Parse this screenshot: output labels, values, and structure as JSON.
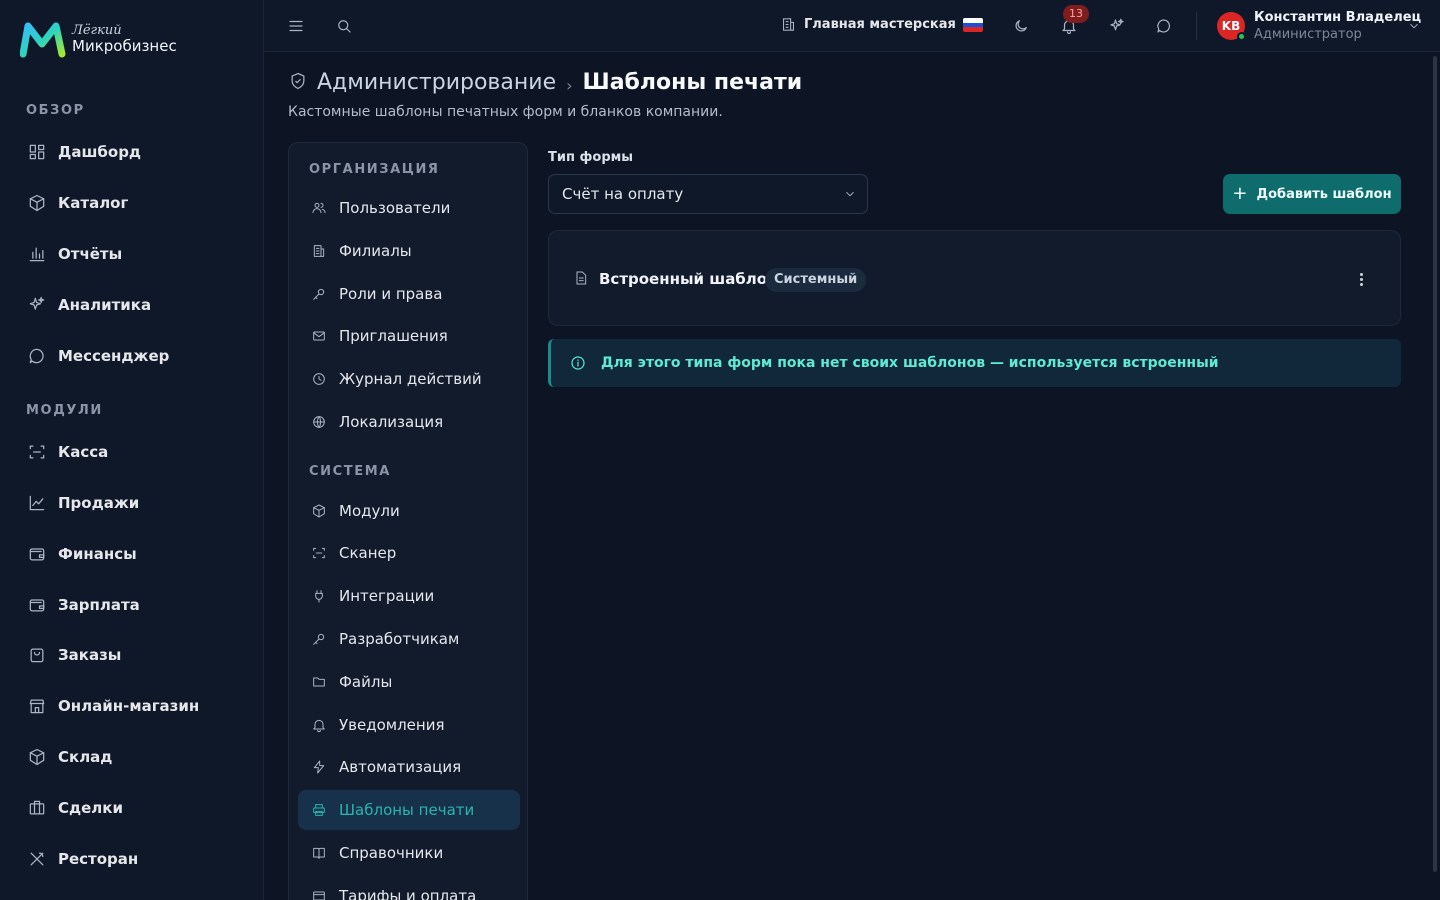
{
  "brand": {
    "top": "Лёгкий",
    "bottom": "Микробизнес"
  },
  "sidebar": {
    "sections": [
      {
        "label": "ОБЗОР"
      },
      {
        "label": "МОДУЛИ"
      }
    ],
    "items": [
      {
        "label": "Дашборд",
        "icon": "dashboard-icon"
      },
      {
        "label": "Каталог",
        "icon": "catalog-icon"
      },
      {
        "label": "Отчёты",
        "icon": "bar-chart-icon"
      },
      {
        "label": "Аналитика",
        "icon": "sparkles-icon"
      },
      {
        "label": "Мессенджер",
        "icon": "chat-icon"
      },
      {
        "label": "Касса",
        "icon": "scan-icon"
      },
      {
        "label": "Продажи",
        "icon": "line-chart-icon"
      },
      {
        "label": "Финансы",
        "icon": "wallet-icon"
      },
      {
        "label": "Зарплата",
        "icon": "wallet-icon"
      },
      {
        "label": "Заказы",
        "icon": "shopping-bag-icon"
      },
      {
        "label": "Онлайн-магазин",
        "icon": "store-icon"
      },
      {
        "label": "Склад",
        "icon": "box-icon"
      },
      {
        "label": "Сделки",
        "icon": "briefcase-icon"
      },
      {
        "label": "Ресторан",
        "icon": "utensils-icon"
      }
    ]
  },
  "header": {
    "branch": "Главная мастерская",
    "notifications_count": "13",
    "user_initials": "KB",
    "user_name": "Константин Владелец",
    "user_role": "Администратор"
  },
  "page": {
    "breadcrumb_parent": "Администрирование",
    "breadcrumb_sep": "›",
    "title": "Шаблоны печати",
    "subtitle": "Кастомные шаблоны печатных форм и бланков компании."
  },
  "settings_nav": {
    "sections": [
      {
        "label": "ОРГАНИЗАЦИЯ"
      },
      {
        "label": "СИСТЕМА"
      }
    ],
    "items": [
      {
        "label": "Пользователи",
        "icon": "users-icon"
      },
      {
        "label": "Филиалы",
        "icon": "building-icon"
      },
      {
        "label": "Роли и права",
        "icon": "key-icon"
      },
      {
        "label": "Приглашения",
        "icon": "mail-icon"
      },
      {
        "label": "Журнал действий",
        "icon": "history-icon"
      },
      {
        "label": "Локализация",
        "icon": "globe-icon"
      },
      {
        "label": "Модули",
        "icon": "box-icon"
      },
      {
        "label": "Сканер",
        "icon": "scan-icon"
      },
      {
        "label": "Интеграции",
        "icon": "plug-icon"
      },
      {
        "label": "Разработчикам",
        "icon": "key-icon"
      },
      {
        "label": "Файлы",
        "icon": "folder-icon"
      },
      {
        "label": "Уведомления",
        "icon": "bell-icon"
      },
      {
        "label": "Автоматизация",
        "icon": "zap-icon"
      },
      {
        "label": "Шаблоны печати",
        "icon": "printer-icon",
        "active": true
      },
      {
        "label": "Справочники",
        "icon": "book-icon"
      },
      {
        "label": "Тарифы и оплата",
        "icon": "card-icon"
      }
    ]
  },
  "main": {
    "form_type_label": "Тип формы",
    "form_type_value": "Счёт на оплату",
    "add_button": "Добавить шаблон",
    "template_name": "Встроенный шаблон",
    "template_badge": "Системный",
    "info_message": "Для этого типа форм пока нет своих шаблонов — используется встроенный"
  },
  "colors": {
    "accent": "#0f6c6c",
    "accent_text": "#2bb4b0",
    "notice_text": "#5eead4",
    "danger": "#dc2626",
    "online": "#22c55e"
  }
}
